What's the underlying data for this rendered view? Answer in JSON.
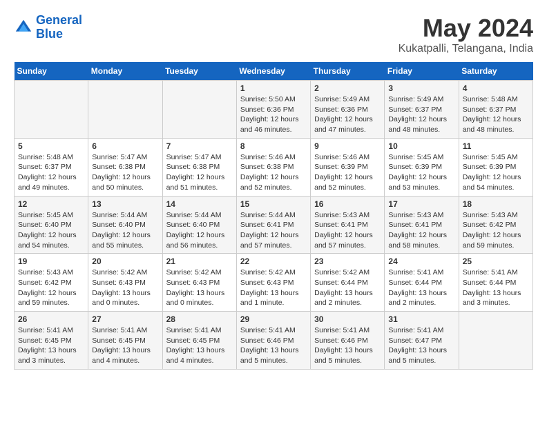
{
  "header": {
    "logo_line1": "General",
    "logo_line2": "Blue",
    "month": "May 2024",
    "location": "Kukatpalli, Telangana, India"
  },
  "weekdays": [
    "Sunday",
    "Monday",
    "Tuesday",
    "Wednesday",
    "Thursday",
    "Friday",
    "Saturday"
  ],
  "weeks": [
    [
      {
        "day": "",
        "info": ""
      },
      {
        "day": "",
        "info": ""
      },
      {
        "day": "",
        "info": ""
      },
      {
        "day": "1",
        "info": "Sunrise: 5:50 AM\nSunset: 6:36 PM\nDaylight: 12 hours\nand 46 minutes."
      },
      {
        "day": "2",
        "info": "Sunrise: 5:49 AM\nSunset: 6:36 PM\nDaylight: 12 hours\nand 47 minutes."
      },
      {
        "day": "3",
        "info": "Sunrise: 5:49 AM\nSunset: 6:37 PM\nDaylight: 12 hours\nand 48 minutes."
      },
      {
        "day": "4",
        "info": "Sunrise: 5:48 AM\nSunset: 6:37 PM\nDaylight: 12 hours\nand 48 minutes."
      }
    ],
    [
      {
        "day": "5",
        "info": "Sunrise: 5:48 AM\nSunset: 6:37 PM\nDaylight: 12 hours\nand 49 minutes."
      },
      {
        "day": "6",
        "info": "Sunrise: 5:47 AM\nSunset: 6:38 PM\nDaylight: 12 hours\nand 50 minutes."
      },
      {
        "day": "7",
        "info": "Sunrise: 5:47 AM\nSunset: 6:38 PM\nDaylight: 12 hours\nand 51 minutes."
      },
      {
        "day": "8",
        "info": "Sunrise: 5:46 AM\nSunset: 6:38 PM\nDaylight: 12 hours\nand 52 minutes."
      },
      {
        "day": "9",
        "info": "Sunrise: 5:46 AM\nSunset: 6:39 PM\nDaylight: 12 hours\nand 52 minutes."
      },
      {
        "day": "10",
        "info": "Sunrise: 5:45 AM\nSunset: 6:39 PM\nDaylight: 12 hours\nand 53 minutes."
      },
      {
        "day": "11",
        "info": "Sunrise: 5:45 AM\nSunset: 6:39 PM\nDaylight: 12 hours\nand 54 minutes."
      }
    ],
    [
      {
        "day": "12",
        "info": "Sunrise: 5:45 AM\nSunset: 6:40 PM\nDaylight: 12 hours\nand 54 minutes."
      },
      {
        "day": "13",
        "info": "Sunrise: 5:44 AM\nSunset: 6:40 PM\nDaylight: 12 hours\nand 55 minutes."
      },
      {
        "day": "14",
        "info": "Sunrise: 5:44 AM\nSunset: 6:40 PM\nDaylight: 12 hours\nand 56 minutes."
      },
      {
        "day": "15",
        "info": "Sunrise: 5:44 AM\nSunset: 6:41 PM\nDaylight: 12 hours\nand 57 minutes."
      },
      {
        "day": "16",
        "info": "Sunrise: 5:43 AM\nSunset: 6:41 PM\nDaylight: 12 hours\nand 57 minutes."
      },
      {
        "day": "17",
        "info": "Sunrise: 5:43 AM\nSunset: 6:41 PM\nDaylight: 12 hours\nand 58 minutes."
      },
      {
        "day": "18",
        "info": "Sunrise: 5:43 AM\nSunset: 6:42 PM\nDaylight: 12 hours\nand 59 minutes."
      }
    ],
    [
      {
        "day": "19",
        "info": "Sunrise: 5:43 AM\nSunset: 6:42 PM\nDaylight: 12 hours\nand 59 minutes."
      },
      {
        "day": "20",
        "info": "Sunrise: 5:42 AM\nSunset: 6:43 PM\nDaylight: 13 hours\nand 0 minutes."
      },
      {
        "day": "21",
        "info": "Sunrise: 5:42 AM\nSunset: 6:43 PM\nDaylight: 13 hours\nand 0 minutes."
      },
      {
        "day": "22",
        "info": "Sunrise: 5:42 AM\nSunset: 6:43 PM\nDaylight: 13 hours\nand 1 minute."
      },
      {
        "day": "23",
        "info": "Sunrise: 5:42 AM\nSunset: 6:44 PM\nDaylight: 13 hours\nand 2 minutes."
      },
      {
        "day": "24",
        "info": "Sunrise: 5:41 AM\nSunset: 6:44 PM\nDaylight: 13 hours\nand 2 minutes."
      },
      {
        "day": "25",
        "info": "Sunrise: 5:41 AM\nSunset: 6:44 PM\nDaylight: 13 hours\nand 3 minutes."
      }
    ],
    [
      {
        "day": "26",
        "info": "Sunrise: 5:41 AM\nSunset: 6:45 PM\nDaylight: 13 hours\nand 3 minutes."
      },
      {
        "day": "27",
        "info": "Sunrise: 5:41 AM\nSunset: 6:45 PM\nDaylight: 13 hours\nand 4 minutes."
      },
      {
        "day": "28",
        "info": "Sunrise: 5:41 AM\nSunset: 6:45 PM\nDaylight: 13 hours\nand 4 minutes."
      },
      {
        "day": "29",
        "info": "Sunrise: 5:41 AM\nSunset: 6:46 PM\nDaylight: 13 hours\nand 5 minutes."
      },
      {
        "day": "30",
        "info": "Sunrise: 5:41 AM\nSunset: 6:46 PM\nDaylight: 13 hours\nand 5 minutes."
      },
      {
        "day": "31",
        "info": "Sunrise: 5:41 AM\nSunset: 6:47 PM\nDaylight: 13 hours\nand 5 minutes."
      },
      {
        "day": "",
        "info": ""
      }
    ]
  ]
}
